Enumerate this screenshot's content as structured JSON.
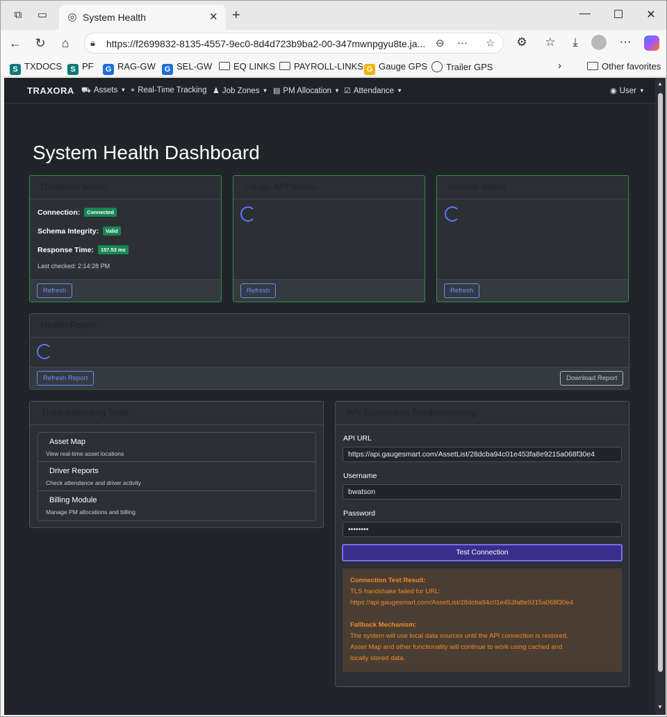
{
  "browser": {
    "tab_title": "System Health",
    "url": "https://f2699832-8135-4557-9ec0-8d4d723b9ba2-00-347mwnpgyu8te.ja...",
    "bookmarks": [
      {
        "label": "TXDOCS",
        "icon": "sharepoint-icon"
      },
      {
        "label": "PF",
        "icon": "sharepoint-icon"
      },
      {
        "label": "RAG-GW",
        "icon": "g-app-icon"
      },
      {
        "label": "SEL-GW",
        "icon": "g-app-icon"
      },
      {
        "label": "EQ LINKS",
        "icon": "folder-icon"
      },
      {
        "label": "PAYROLL-LINKS",
        "icon": "folder-icon"
      },
      {
        "label": "Gauge GPS",
        "icon": "gauge-icon"
      },
      {
        "label": "Trailer GPS",
        "icon": "globe-icon"
      }
    ],
    "other_favorites": "Other favorites"
  },
  "app": {
    "brand": "TRAXORA",
    "nav": [
      {
        "label": "Assets",
        "icon": "truck-icon"
      },
      {
        "label": "Real-Time Tracking",
        "icon": "map-pin-icon"
      },
      {
        "label": "Job Zones",
        "icon": "person-pin-icon"
      },
      {
        "label": "PM Allocation",
        "icon": "document-icon"
      },
      {
        "label": "Attendance",
        "icon": "calendar-check-icon"
      }
    ],
    "user": "User"
  },
  "page": {
    "title": "System Health Dashboard"
  },
  "database_status": {
    "title": "Database Status",
    "connection_label": "Connection:",
    "connection_value": "Connected",
    "schema_label": "Schema Integrity:",
    "schema_value": "Valid",
    "response_label": "Response Time:",
    "response_value": "157.53 ms",
    "last_checked": "Last checked: 2:14:28 PM",
    "refresh": "Refresh"
  },
  "gauge_api_status": {
    "title": "Gauge API Status",
    "refresh": "Refresh"
  },
  "system_status": {
    "title": "System Status",
    "refresh": "Refresh"
  },
  "health_report": {
    "title": "Health Report",
    "refresh": "Refresh Report",
    "download": "Download Report"
  },
  "troubleshooting": {
    "title": "Troubleshooting Tools",
    "items": [
      {
        "title": "Asset Map",
        "subtitle": "View real-time asset locations"
      },
      {
        "title": "Driver Reports",
        "subtitle": "Check attendance and driver activity"
      },
      {
        "title": "Billing Module",
        "subtitle": "Manage PM allocations and billing"
      }
    ]
  },
  "api_troubleshooting": {
    "title": "API Connection Troubleshooting",
    "api_url_label": "API URL",
    "api_url_value": "https://api.gaugesmart.com/AssetList/28dcba94c01e453fa8e9215a068f30e4",
    "username_label": "Username",
    "username_value": "bwatson",
    "password_label": "Password",
    "password_value": "••••••••",
    "test_button": "Test Connection",
    "result": {
      "heading": "Connection Test Result:",
      "line1": "TLS handshake failed for URL:",
      "line2": "https://api.gaugesmart.com/AssetList/28dcba94c01e453fa8e9215a068f30e4",
      "fallback_heading": "Fallback Mechanism:",
      "fallback_line1": "The system will use local data sources until the API connection is restored.",
      "fallback_line2": "Asset Map and other functionality will continue to work using cached and",
      "fallback_line3": "locally stored data."
    }
  },
  "colors": {
    "background": "#212529",
    "card": "#2c3035",
    "success": "#198754",
    "accent": "#6d8cff",
    "warning_text": "#f08c22"
  }
}
